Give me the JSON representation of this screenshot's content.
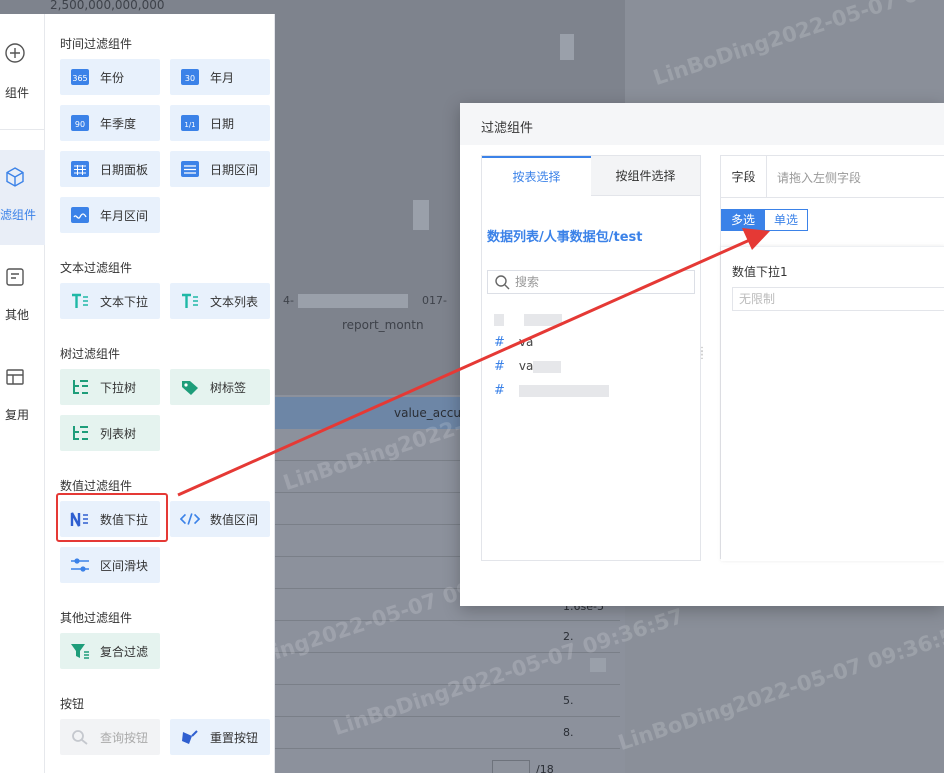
{
  "background": {
    "y_axis_top_label": "2,500,000,000,000",
    "x_axis_title": "report_montn",
    "tick_left": "4-",
    "tick_right": "017-",
    "table_column": "value_accum",
    "cells": [
      "1.6se-5",
      "2.",
      "5.",
      "8."
    ],
    "pager_total": "/18",
    "watermark": "LinBoDing2022-05-07 09:36:57"
  },
  "rail": {
    "items": [
      {
        "label": "组件",
        "icon": "plus-circle-icon"
      },
      {
        "label": "滤组件",
        "icon": "cube-icon"
      },
      {
        "label": "其他",
        "icon": "other-icon"
      },
      {
        "label": "复用",
        "icon": "reuse-icon"
      }
    ]
  },
  "panel": {
    "groups": {
      "time": "时间过滤组件",
      "text": "文本过滤组件",
      "tree": "树过滤组件",
      "number": "数值过滤组件",
      "other": "其他过滤组件",
      "button": "按钮"
    },
    "components": {
      "year": "年份",
      "year_month": "年月",
      "year_quarter": "年季度",
      "date": "日期",
      "date_panel": "日期面板",
      "date_range": "日期区间",
      "year_month_range": "年月区间",
      "text_dropdown": "文本下拉",
      "text_list": "文本列表",
      "dropdown_tree": "下拉树",
      "tree_tag": "树标签",
      "list_tree": "列表树",
      "number_dropdown": "数值下拉",
      "number_range": "数值区间",
      "range_slider": "区间滑块",
      "composite_filter": "复合过滤",
      "query_button": "查询按钮",
      "reset_button": "重置按钮"
    },
    "icon_text": {
      "year": "365",
      "year_month": "30",
      "year_quarter": "90",
      "date": "1/1"
    }
  },
  "dialog": {
    "title": "过滤组件",
    "tabs": [
      "按表选择",
      "按组件选择"
    ],
    "active_tab": 0,
    "dataset_path": "数据列表/人事数据包/test",
    "search_placeholder": "搜索",
    "fields": [
      {
        "type": "#",
        "name": "va"
      },
      {
        "type": "#",
        "name": "va"
      }
    ],
    "field_label": "字段",
    "field_placeholder": "请拖入左侧字段",
    "selection_modes": [
      "多选",
      "单选"
    ],
    "selected_mode": "多选",
    "component_title": "数值下拉1",
    "component_value": "无限制"
  },
  "colors": {
    "accent": "#3b82e8",
    "highlight": "#e53935"
  }
}
